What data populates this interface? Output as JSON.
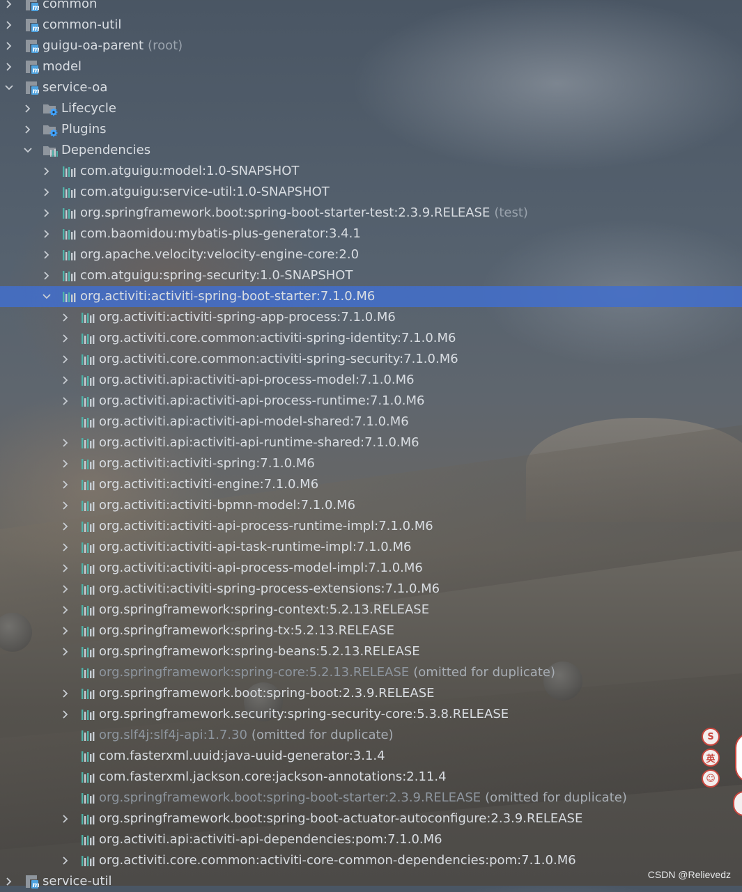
{
  "colors": {
    "selection": "#426ecc",
    "text": "#d9dde2",
    "dim_text": "#9aa3ad",
    "module_icon_blue": "#4fa3e0",
    "module_icon_orange": "#e29b3a",
    "folder_gray": "#8f969e",
    "gear_blue": "#3fa3ff",
    "lib_bars_light": "#c8cdd3",
    "lib_bars_teal": "#4fb3a9"
  },
  "tree": [
    {
      "label": "common",
      "suffix": "",
      "level": 0,
      "icon": "module-icon",
      "chevron": "right",
      "selected": false,
      "omitted": false
    },
    {
      "label": "common-util",
      "suffix": "",
      "level": 0,
      "icon": "module-icon",
      "chevron": "right",
      "selected": false,
      "omitted": false
    },
    {
      "label": "guigu-oa-parent",
      "suffix": "(root)",
      "level": 0,
      "icon": "module-icon",
      "chevron": "right",
      "selected": false,
      "omitted": false
    },
    {
      "label": "model",
      "suffix": "",
      "level": 0,
      "icon": "module-icon",
      "chevron": "right",
      "selected": false,
      "omitted": false
    },
    {
      "label": "service-oa",
      "suffix": "",
      "level": 0,
      "icon": "module-icon",
      "chevron": "down",
      "selected": false,
      "omitted": false
    },
    {
      "label": "Lifecycle",
      "suffix": "",
      "level": 1,
      "icon": "folder-gear-icon",
      "chevron": "right",
      "selected": false,
      "omitted": false
    },
    {
      "label": "Plugins",
      "suffix": "",
      "level": 1,
      "icon": "folder-gear-icon",
      "chevron": "right",
      "selected": false,
      "omitted": false
    },
    {
      "label": "Dependencies",
      "suffix": "",
      "level": 1,
      "icon": "folder-library-icon",
      "chevron": "down",
      "selected": false,
      "omitted": false
    },
    {
      "label": "com.atguigu:model:1.0-SNAPSHOT",
      "suffix": "",
      "level": 2,
      "icon": "library-icon",
      "chevron": "right",
      "selected": false,
      "omitted": false
    },
    {
      "label": "com.atguigu:service-util:1.0-SNAPSHOT",
      "suffix": "",
      "level": 2,
      "icon": "library-icon",
      "chevron": "right",
      "selected": false,
      "omitted": false
    },
    {
      "label": "org.springframework.boot:spring-boot-starter-test:2.3.9.RELEASE",
      "suffix": "(test)",
      "level": 2,
      "icon": "library-icon",
      "chevron": "right",
      "selected": false,
      "omitted": false
    },
    {
      "label": "com.baomidou:mybatis-plus-generator:3.4.1",
      "suffix": "",
      "level": 2,
      "icon": "library-icon",
      "chevron": "right",
      "selected": false,
      "omitted": false
    },
    {
      "label": "org.apache.velocity:velocity-engine-core:2.0",
      "suffix": "",
      "level": 2,
      "icon": "library-icon",
      "chevron": "right",
      "selected": false,
      "omitted": false
    },
    {
      "label": "com.atguigu:spring-security:1.0-SNAPSHOT",
      "suffix": "",
      "level": 2,
      "icon": "library-icon",
      "chevron": "right",
      "selected": false,
      "omitted": false
    },
    {
      "label": "org.activiti:activiti-spring-boot-starter:7.1.0.M6",
      "suffix": "",
      "level": 2,
      "icon": "library-icon",
      "chevron": "down",
      "selected": true,
      "omitted": false
    },
    {
      "label": "org.activiti:activiti-spring-app-process:7.1.0.M6",
      "suffix": "",
      "level": 3,
      "icon": "library-icon",
      "chevron": "right",
      "selected": false,
      "omitted": false
    },
    {
      "label": "org.activiti.core.common:activiti-spring-identity:7.1.0.M6",
      "suffix": "",
      "level": 3,
      "icon": "library-icon",
      "chevron": "right",
      "selected": false,
      "omitted": false
    },
    {
      "label": "org.activiti.core.common:activiti-spring-security:7.1.0.M6",
      "suffix": "",
      "level": 3,
      "icon": "library-icon",
      "chevron": "right",
      "selected": false,
      "omitted": false
    },
    {
      "label": "org.activiti.api:activiti-api-process-model:7.1.0.M6",
      "suffix": "",
      "level": 3,
      "icon": "library-icon",
      "chevron": "right",
      "selected": false,
      "omitted": false
    },
    {
      "label": "org.activiti.api:activiti-api-process-runtime:7.1.0.M6",
      "suffix": "",
      "level": 3,
      "icon": "library-icon",
      "chevron": "right",
      "selected": false,
      "omitted": false
    },
    {
      "label": "org.activiti.api:activiti-api-model-shared:7.1.0.M6",
      "suffix": "",
      "level": 3,
      "icon": "library-icon",
      "chevron": "none",
      "selected": false,
      "omitted": false
    },
    {
      "label": "org.activiti.api:activiti-api-runtime-shared:7.1.0.M6",
      "suffix": "",
      "level": 3,
      "icon": "library-icon",
      "chevron": "right",
      "selected": false,
      "omitted": false
    },
    {
      "label": "org.activiti:activiti-spring:7.1.0.M6",
      "suffix": "",
      "level": 3,
      "icon": "library-icon",
      "chevron": "right",
      "selected": false,
      "omitted": false
    },
    {
      "label": "org.activiti:activiti-engine:7.1.0.M6",
      "suffix": "",
      "level": 3,
      "icon": "library-icon",
      "chevron": "right",
      "selected": false,
      "omitted": false
    },
    {
      "label": "org.activiti:activiti-bpmn-model:7.1.0.M6",
      "suffix": "",
      "level": 3,
      "icon": "library-icon",
      "chevron": "right",
      "selected": false,
      "omitted": false
    },
    {
      "label": "org.activiti:activiti-api-process-runtime-impl:7.1.0.M6",
      "suffix": "",
      "level": 3,
      "icon": "library-icon",
      "chevron": "right",
      "selected": false,
      "omitted": false
    },
    {
      "label": "org.activiti:activiti-api-task-runtime-impl:7.1.0.M6",
      "suffix": "",
      "level": 3,
      "icon": "library-icon",
      "chevron": "right",
      "selected": false,
      "omitted": false
    },
    {
      "label": "org.activiti:activiti-api-process-model-impl:7.1.0.M6",
      "suffix": "",
      "level": 3,
      "icon": "library-icon",
      "chevron": "right",
      "selected": false,
      "omitted": false
    },
    {
      "label": "org.activiti:activiti-spring-process-extensions:7.1.0.M6",
      "suffix": "",
      "level": 3,
      "icon": "library-icon",
      "chevron": "right",
      "selected": false,
      "omitted": false
    },
    {
      "label": "org.springframework:spring-context:5.2.13.RELEASE",
      "suffix": "",
      "level": 3,
      "icon": "library-icon",
      "chevron": "right",
      "selected": false,
      "omitted": false
    },
    {
      "label": "org.springframework:spring-tx:5.2.13.RELEASE",
      "suffix": "",
      "level": 3,
      "icon": "library-icon",
      "chevron": "right",
      "selected": false,
      "omitted": false
    },
    {
      "label": "org.springframework:spring-beans:5.2.13.RELEASE",
      "suffix": "",
      "level": 3,
      "icon": "library-icon",
      "chevron": "right",
      "selected": false,
      "omitted": false
    },
    {
      "label": "org.springframework:spring-core:5.2.13.RELEASE",
      "suffix": "(omitted for duplicate)",
      "level": 3,
      "icon": "library-icon",
      "chevron": "none",
      "selected": false,
      "omitted": true
    },
    {
      "label": "org.springframework.boot:spring-boot:2.3.9.RELEASE",
      "suffix": "",
      "level": 3,
      "icon": "library-icon",
      "chevron": "right",
      "selected": false,
      "omitted": false
    },
    {
      "label": "org.springframework.security:spring-security-core:5.3.8.RELEASE",
      "suffix": "",
      "level": 3,
      "icon": "library-icon",
      "chevron": "right",
      "selected": false,
      "omitted": false
    },
    {
      "label": "org.slf4j:slf4j-api:1.7.30",
      "suffix": "(omitted for duplicate)",
      "level": 3,
      "icon": "library-icon",
      "chevron": "none",
      "selected": false,
      "omitted": true
    },
    {
      "label": "com.fasterxml.uuid:java-uuid-generator:3.1.4",
      "suffix": "",
      "level": 3,
      "icon": "library-icon",
      "chevron": "none",
      "selected": false,
      "omitted": false
    },
    {
      "label": "com.fasterxml.jackson.core:jackson-annotations:2.11.4",
      "suffix": "",
      "level": 3,
      "icon": "library-icon",
      "chevron": "none",
      "selected": false,
      "omitted": false
    },
    {
      "label": "org.springframework.boot:spring-boot-starter:2.3.9.RELEASE",
      "suffix": "(omitted for duplicate)",
      "level": 3,
      "icon": "library-icon",
      "chevron": "none",
      "selected": false,
      "omitted": true
    },
    {
      "label": "org.springframework.boot:spring-boot-actuator-autoconfigure:2.3.9.RELEASE",
      "suffix": "",
      "level": 3,
      "icon": "library-icon",
      "chevron": "right",
      "selected": false,
      "omitted": false
    },
    {
      "label": "org.activiti.api:activiti-api-dependencies:pom:7.1.0.M6",
      "suffix": "",
      "level": 3,
      "icon": "library-icon",
      "chevron": "none",
      "selected": false,
      "omitted": false
    },
    {
      "label": "org.activiti.core.common:activiti-core-common-dependencies:pom:7.1.0.M6",
      "suffix": "",
      "level": 3,
      "icon": "library-icon",
      "chevron": "right",
      "selected": false,
      "omitted": false
    },
    {
      "label": "service-util",
      "suffix": "",
      "level": 0,
      "icon": "module-icon",
      "chevron": "right",
      "selected": false,
      "omitted": false
    }
  ],
  "ime_toolbar": {
    "sogou_glyph": "S",
    "lang_glyph": "英",
    "skin_glyph": "☺"
  },
  "watermark": "CSDN @Relievedz"
}
